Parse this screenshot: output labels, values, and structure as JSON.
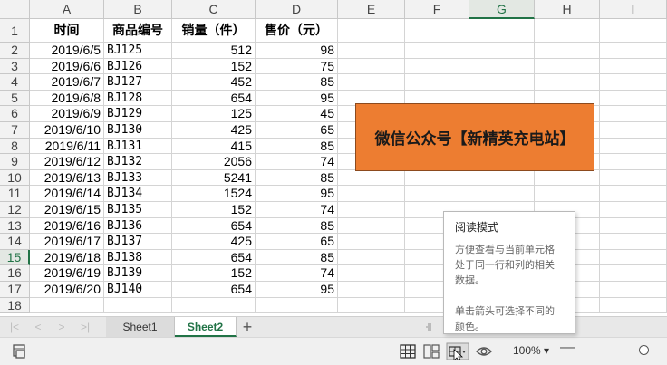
{
  "columns": [
    "A",
    "B",
    "C",
    "D",
    "E",
    "F",
    "G",
    "H",
    "I"
  ],
  "selected_column": "G",
  "selected_row": 15,
  "rows": [
    1,
    2,
    3,
    4,
    5,
    6,
    7,
    8,
    9,
    10,
    11,
    12,
    13,
    14,
    15,
    16,
    17,
    18
  ],
  "header_row": [
    "时间",
    "商品编号",
    "销量（件）",
    "售价（元）"
  ],
  "data_rows": [
    [
      "2019/6/5",
      "BJ125",
      "512",
      "98"
    ],
    [
      "2019/6/6",
      "BJ126",
      "152",
      "75"
    ],
    [
      "2019/6/7",
      "BJ127",
      "452",
      "85"
    ],
    [
      "2019/6/8",
      "BJ128",
      "654",
      "95"
    ],
    [
      "2019/6/9",
      "BJ129",
      "125",
      "45"
    ],
    [
      "2019/6/10",
      "BJ130",
      "425",
      "65"
    ],
    [
      "2019/6/11",
      "BJ131",
      "415",
      "85"
    ],
    [
      "2019/6/12",
      "BJ132",
      "2056",
      "74"
    ],
    [
      "2019/6/13",
      "BJ133",
      "5241",
      "85"
    ],
    [
      "2019/6/14",
      "BJ134",
      "1524",
      "95"
    ],
    [
      "2019/6/15",
      "BJ135",
      "152",
      "74"
    ],
    [
      "2019/6/16",
      "BJ136",
      "654",
      "85"
    ],
    [
      "2019/6/17",
      "BJ137",
      "425",
      "65"
    ],
    [
      "2019/6/18",
      "BJ138",
      "654",
      "85"
    ],
    [
      "2019/6/19",
      "BJ139",
      "152",
      "74"
    ],
    [
      "2019/6/20",
      "BJ140",
      "654",
      "95"
    ]
  ],
  "text_box": "微信公众号【新精英充电站】",
  "tooltip": {
    "title": "阅读模式",
    "body": "方便查看与当前单元格\n处于同一行和列的相关\n数据。\n\n单击箭头可选择不同的\n颜色。"
  },
  "sheets": [
    "Sheet1",
    "Sheet2"
  ],
  "active_sheet": "Sheet2",
  "status": {
    "zoom": "100%",
    "icons": [
      "macro-record-icon",
      "normal-view-icon",
      "page-break-view-icon",
      "reading-mode-icon",
      "eye-protection-icon",
      "zoom-minus-icon"
    ]
  },
  "colors": {
    "accent": "#217346",
    "textbox_fill": "#ed7d31"
  }
}
